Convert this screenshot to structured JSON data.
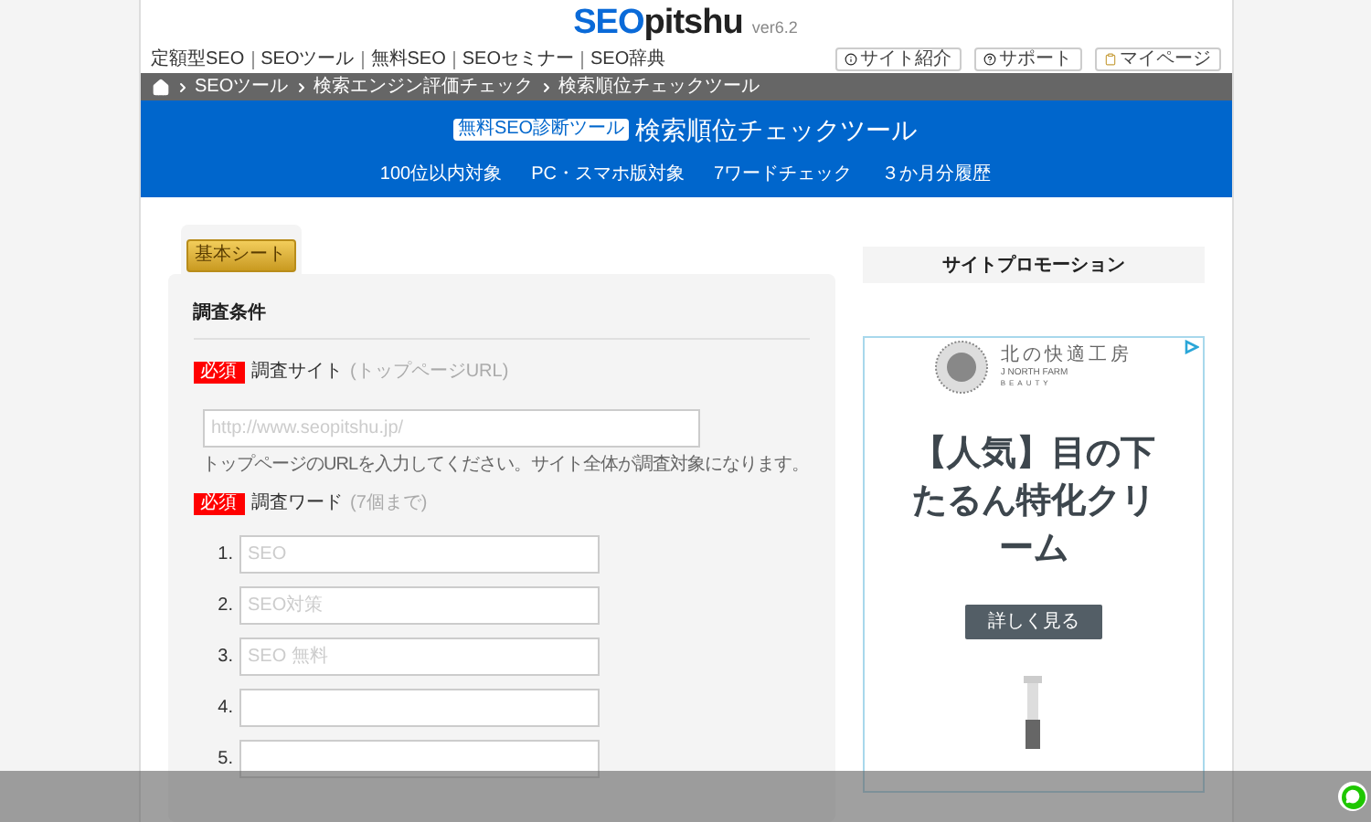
{
  "header": {
    "logo_main": "SEO",
    "logo_rest": "pitshu",
    "version": "ver6.2",
    "nav": [
      "定額型SEO",
      "SEOツール",
      "無料SEO",
      "SEOセミナー",
      "SEO辞典"
    ],
    "buttons": [
      "サイト紹介",
      "サポート",
      "マイページ"
    ]
  },
  "breadcrumb": [
    "SEOツール",
    "検索エンジン評価チェック",
    "検索順位チェックツール"
  ],
  "hero": {
    "badge": "無料SEO診断ツール",
    "title": "検索順位チェックツール",
    "features": [
      "100位以内対象",
      "PC・スマホ版対象",
      "7ワードチェック",
      "３か月分履歴"
    ]
  },
  "tabs": [
    {
      "label": "基本シート",
      "selected": true
    }
  ],
  "form": {
    "heading": "調査条件",
    "site": {
      "required": "必須",
      "label": "調査サイト",
      "note": "(トップページURL)",
      "placeholder": "http://www.seopitshu.jp/",
      "help": "トップページのURLを入力してください。サイト全体が調査対象になります。"
    },
    "words": {
      "required": "必須",
      "label": "調査ワード",
      "note": "(7個まで)",
      "fields": [
        {
          "number": "1.",
          "placeholder": "SEO"
        },
        {
          "number": "2.",
          "placeholder": "SEO対策"
        },
        {
          "number": "3.",
          "placeholder": "SEO 無料"
        },
        {
          "number": "4."
        },
        {
          "number": "5."
        }
      ]
    }
  },
  "sidebar": {
    "heading": "サイトプロモーション",
    "ad": {
      "brand": "北の快適工房",
      "brand_sub": "J NORTH FARM",
      "brand_sub2": "BEAUTY",
      "headline": "【人気】目の下たるん特化クリーム",
      "cta": "詳しく見る"
    }
  }
}
